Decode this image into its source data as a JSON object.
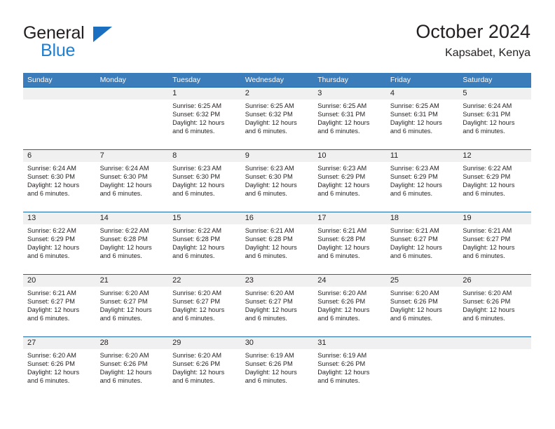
{
  "brand": {
    "name_part1": "General",
    "name_part2": "Blue",
    "logo_icon": "triangle-logo-icon"
  },
  "header": {
    "title": "October 2024",
    "subtitle": "Kapsabet, Kenya"
  },
  "colors": {
    "header_blue": "#3b7cba",
    "row_border_blue": "#1b66ab",
    "daynum_band": "#f0f0f0",
    "brand_blue": "#1f7fd0",
    "text": "#231f20"
  },
  "weekdays": [
    {
      "label": "Sunday"
    },
    {
      "label": "Monday"
    },
    {
      "label": "Tuesday"
    },
    {
      "label": "Wednesday"
    },
    {
      "label": "Thursday"
    },
    {
      "label": "Friday"
    },
    {
      "label": "Saturday"
    }
  ],
  "weeks": [
    [
      {
        "day": "",
        "sunrise": "",
        "sunset": "",
        "daylight_line1": "",
        "daylight_line2": "",
        "empty": true
      },
      {
        "day": "",
        "sunrise": "",
        "sunset": "",
        "daylight_line1": "",
        "daylight_line2": "",
        "empty": true
      },
      {
        "day": "1",
        "sunrise": "Sunrise: 6:25 AM",
        "sunset": "Sunset: 6:32 PM",
        "daylight_line1": "Daylight: 12 hours",
        "daylight_line2": "and 6 minutes."
      },
      {
        "day": "2",
        "sunrise": "Sunrise: 6:25 AM",
        "sunset": "Sunset: 6:32 PM",
        "daylight_line1": "Daylight: 12 hours",
        "daylight_line2": "and 6 minutes."
      },
      {
        "day": "3",
        "sunrise": "Sunrise: 6:25 AM",
        "sunset": "Sunset: 6:31 PM",
        "daylight_line1": "Daylight: 12 hours",
        "daylight_line2": "and 6 minutes."
      },
      {
        "day": "4",
        "sunrise": "Sunrise: 6:25 AM",
        "sunset": "Sunset: 6:31 PM",
        "daylight_line1": "Daylight: 12 hours",
        "daylight_line2": "and 6 minutes."
      },
      {
        "day": "5",
        "sunrise": "Sunrise: 6:24 AM",
        "sunset": "Sunset: 6:31 PM",
        "daylight_line1": "Daylight: 12 hours",
        "daylight_line2": "and 6 minutes."
      }
    ],
    [
      {
        "day": "6",
        "sunrise": "Sunrise: 6:24 AM",
        "sunset": "Sunset: 6:30 PM",
        "daylight_line1": "Daylight: 12 hours",
        "daylight_line2": "and 6 minutes."
      },
      {
        "day": "7",
        "sunrise": "Sunrise: 6:24 AM",
        "sunset": "Sunset: 6:30 PM",
        "daylight_line1": "Daylight: 12 hours",
        "daylight_line2": "and 6 minutes."
      },
      {
        "day": "8",
        "sunrise": "Sunrise: 6:23 AM",
        "sunset": "Sunset: 6:30 PM",
        "daylight_line1": "Daylight: 12 hours",
        "daylight_line2": "and 6 minutes."
      },
      {
        "day": "9",
        "sunrise": "Sunrise: 6:23 AM",
        "sunset": "Sunset: 6:30 PM",
        "daylight_line1": "Daylight: 12 hours",
        "daylight_line2": "and 6 minutes."
      },
      {
        "day": "10",
        "sunrise": "Sunrise: 6:23 AM",
        "sunset": "Sunset: 6:29 PM",
        "daylight_line1": "Daylight: 12 hours",
        "daylight_line2": "and 6 minutes."
      },
      {
        "day": "11",
        "sunrise": "Sunrise: 6:23 AM",
        "sunset": "Sunset: 6:29 PM",
        "daylight_line1": "Daylight: 12 hours",
        "daylight_line2": "and 6 minutes."
      },
      {
        "day": "12",
        "sunrise": "Sunrise: 6:22 AM",
        "sunset": "Sunset: 6:29 PM",
        "daylight_line1": "Daylight: 12 hours",
        "daylight_line2": "and 6 minutes."
      }
    ],
    [
      {
        "day": "13",
        "sunrise": "Sunrise: 6:22 AM",
        "sunset": "Sunset: 6:29 PM",
        "daylight_line1": "Daylight: 12 hours",
        "daylight_line2": "and 6 minutes."
      },
      {
        "day": "14",
        "sunrise": "Sunrise: 6:22 AM",
        "sunset": "Sunset: 6:28 PM",
        "daylight_line1": "Daylight: 12 hours",
        "daylight_line2": "and 6 minutes."
      },
      {
        "day": "15",
        "sunrise": "Sunrise: 6:22 AM",
        "sunset": "Sunset: 6:28 PM",
        "daylight_line1": "Daylight: 12 hours",
        "daylight_line2": "and 6 minutes."
      },
      {
        "day": "16",
        "sunrise": "Sunrise: 6:21 AM",
        "sunset": "Sunset: 6:28 PM",
        "daylight_line1": "Daylight: 12 hours",
        "daylight_line2": "and 6 minutes."
      },
      {
        "day": "17",
        "sunrise": "Sunrise: 6:21 AM",
        "sunset": "Sunset: 6:28 PM",
        "daylight_line1": "Daylight: 12 hours",
        "daylight_line2": "and 6 minutes."
      },
      {
        "day": "18",
        "sunrise": "Sunrise: 6:21 AM",
        "sunset": "Sunset: 6:27 PM",
        "daylight_line1": "Daylight: 12 hours",
        "daylight_line2": "and 6 minutes."
      },
      {
        "day": "19",
        "sunrise": "Sunrise: 6:21 AM",
        "sunset": "Sunset: 6:27 PM",
        "daylight_line1": "Daylight: 12 hours",
        "daylight_line2": "and 6 minutes."
      }
    ],
    [
      {
        "day": "20",
        "sunrise": "Sunrise: 6:21 AM",
        "sunset": "Sunset: 6:27 PM",
        "daylight_line1": "Daylight: 12 hours",
        "daylight_line2": "and 6 minutes."
      },
      {
        "day": "21",
        "sunrise": "Sunrise: 6:20 AM",
        "sunset": "Sunset: 6:27 PM",
        "daylight_line1": "Daylight: 12 hours",
        "daylight_line2": "and 6 minutes."
      },
      {
        "day": "22",
        "sunrise": "Sunrise: 6:20 AM",
        "sunset": "Sunset: 6:27 PM",
        "daylight_line1": "Daylight: 12 hours",
        "daylight_line2": "and 6 minutes."
      },
      {
        "day": "23",
        "sunrise": "Sunrise: 6:20 AM",
        "sunset": "Sunset: 6:27 PM",
        "daylight_line1": "Daylight: 12 hours",
        "daylight_line2": "and 6 minutes."
      },
      {
        "day": "24",
        "sunrise": "Sunrise: 6:20 AM",
        "sunset": "Sunset: 6:26 PM",
        "daylight_line1": "Daylight: 12 hours",
        "daylight_line2": "and 6 minutes."
      },
      {
        "day": "25",
        "sunrise": "Sunrise: 6:20 AM",
        "sunset": "Sunset: 6:26 PM",
        "daylight_line1": "Daylight: 12 hours",
        "daylight_line2": "and 6 minutes."
      },
      {
        "day": "26",
        "sunrise": "Sunrise: 6:20 AM",
        "sunset": "Sunset: 6:26 PM",
        "daylight_line1": "Daylight: 12 hours",
        "daylight_line2": "and 6 minutes."
      }
    ],
    [
      {
        "day": "27",
        "sunrise": "Sunrise: 6:20 AM",
        "sunset": "Sunset: 6:26 PM",
        "daylight_line1": "Daylight: 12 hours",
        "daylight_line2": "and 6 minutes."
      },
      {
        "day": "28",
        "sunrise": "Sunrise: 6:20 AM",
        "sunset": "Sunset: 6:26 PM",
        "daylight_line1": "Daylight: 12 hours",
        "daylight_line2": "and 6 minutes."
      },
      {
        "day": "29",
        "sunrise": "Sunrise: 6:20 AM",
        "sunset": "Sunset: 6:26 PM",
        "daylight_line1": "Daylight: 12 hours",
        "daylight_line2": "and 6 minutes."
      },
      {
        "day": "30",
        "sunrise": "Sunrise: 6:19 AM",
        "sunset": "Sunset: 6:26 PM",
        "daylight_line1": "Daylight: 12 hours",
        "daylight_line2": "and 6 minutes."
      },
      {
        "day": "31",
        "sunrise": "Sunrise: 6:19 AM",
        "sunset": "Sunset: 6:26 PM",
        "daylight_line1": "Daylight: 12 hours",
        "daylight_line2": "and 6 minutes."
      },
      {
        "day": "",
        "sunrise": "",
        "sunset": "",
        "daylight_line1": "",
        "daylight_line2": "",
        "empty": true
      },
      {
        "day": "",
        "sunrise": "",
        "sunset": "",
        "daylight_line1": "",
        "daylight_line2": "",
        "empty": true
      }
    ]
  ]
}
